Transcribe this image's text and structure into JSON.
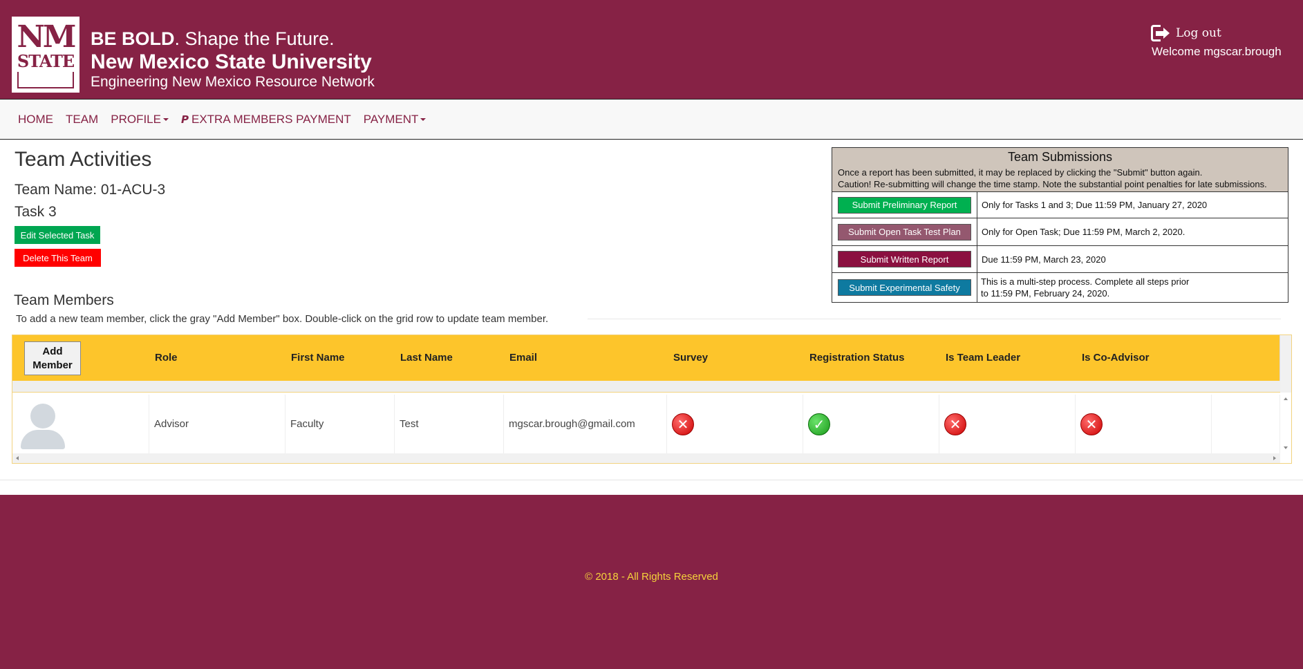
{
  "header": {
    "logo_nm": "NM",
    "logo_state": "STATE",
    "brand_bold": "BE BOLD",
    "brand_rest": ". Shape the Future.",
    "university": "New Mexico State University",
    "network": "Engineering New Mexico Resource Network",
    "logout_label": "Log out",
    "welcome": "Welcome mgscar.brough"
  },
  "nav": {
    "home": "HOME",
    "team": "TEAM",
    "profile": "PROFILE",
    "extra_members": "EXTRA MEMBERS PAYMENT",
    "payment": "PAYMENT"
  },
  "main": {
    "title": "Team Activities",
    "team_name": "Team Name: 01-ACU-3",
    "task": "Task 3",
    "edit_button": "Edit Selected Task",
    "delete_button": "Delete This Team"
  },
  "submissions": {
    "title": "Team Submissions",
    "note1": "Once a report has been submitted, it may be replaced by clicking the \"Submit\" button again.",
    "note2": "Caution! Re-submitting will change the time stamp. Note the substantial point penalties for late submissions.",
    "rows": [
      {
        "label": "Submit Preliminary Report",
        "desc": "Only for Tasks 1 and 3; Due 11:59 PM, January 27, 2020",
        "color": "#00b050"
      },
      {
        "label": "Submit Open Task Test Plan",
        "desc": "Only for Open Task; Due 11:59 PM, March 2, 2020.",
        "color": "#94586f"
      },
      {
        "label": "Submit Written Report",
        "desc": "Due 11:59 PM, March 23, 2020",
        "color": "#8b1040"
      },
      {
        "label": "Submit Experimental Safety",
        "desc1": "This is a multi-step process. Complete all steps prior",
        "desc2": " to 11:59 PM, February 24, 2020.",
        "color": "#0e7aa0"
      }
    ]
  },
  "members": {
    "title": "Team Members",
    "help": "To add a new team member, click the gray \"Add Member\" box. Double-click on the grid row to update team member.",
    "add_button_line1": "Add",
    "add_button_line2": "Member",
    "columns": {
      "role": "Role",
      "first_name": "First Name",
      "last_name": "Last Name",
      "email": "Email",
      "survey": "Survey",
      "registration": "Registration Status",
      "team_leader": "Is Team Leader",
      "co_advisor": "Is Co-Advisor"
    },
    "rows": [
      {
        "role": "Advisor",
        "first_name": "Faculty",
        "last_name": "Test",
        "email": "mgscar.brough@gmail.com",
        "survey": "x-icon",
        "registration": "check-icon",
        "team_leader": "x-icon",
        "co_advisor": "x-icon"
      }
    ]
  },
  "footer": {
    "copyright": "© 2018 - All Rights Reserved"
  }
}
